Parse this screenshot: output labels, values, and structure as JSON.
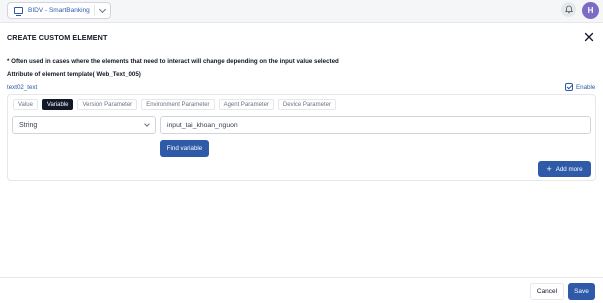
{
  "header": {
    "project_name": "BIDV - SmartBanking",
    "avatar_initial": "H"
  },
  "dialog": {
    "title": "CREATE CUSTOM ELEMENT",
    "note": "* Often used in cases where the elements that need to interact will change depending on the input value selected",
    "attribute_label": "Attribute of element template( Web_Text_005)",
    "element_name": "text02_text",
    "enable_label": "Enable",
    "enable_checked": true,
    "tabs": [
      "Value",
      "Variable",
      "Version Parameter",
      "Environment Parameter",
      "Agent Parameter",
      "Device Parameter"
    ],
    "active_tab": "Variable",
    "type_select_value": "String",
    "variable_input_value": "input_tai_khoan_nguon",
    "find_variable_label": "Find variable",
    "add_more_label": "Add more"
  },
  "footer": {
    "cancel_label": "Cancel",
    "save_label": "Save"
  },
  "colors": {
    "primary": "#2f5aa8",
    "avatar": "#7c6bc4",
    "active_tab": "#111827"
  }
}
